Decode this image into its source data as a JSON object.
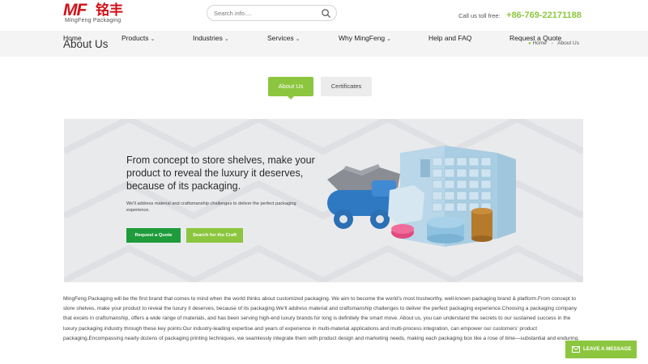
{
  "header": {
    "logo": {
      "mark": "MF",
      "cjk": "铭丰",
      "subtitle": "MingFeng Packaging"
    },
    "search": {
      "placeholder": "Search info....",
      "icon": "search-icon"
    },
    "tollfree": {
      "label": "Call us toll free:",
      "number": "+86-769-22171188"
    }
  },
  "nav": {
    "items": [
      {
        "label": "Home",
        "dropdown": false
      },
      {
        "label": "Products",
        "dropdown": true
      },
      {
        "label": "Industries",
        "dropdown": true
      },
      {
        "label": "Services",
        "dropdown": true
      },
      {
        "label": "Why MingFeng",
        "dropdown": true
      },
      {
        "label": "Help and FAQ",
        "dropdown": false
      },
      {
        "label": "Request a Quote",
        "dropdown": false
      }
    ],
    "chevron": "⌄"
  },
  "banner": {
    "title": "About Us",
    "breadcrumb": {
      "home": "Home",
      "current": "About Us"
    }
  },
  "tabs": [
    {
      "label": "About Us",
      "active": true
    },
    {
      "label": "Certificates",
      "active": false
    }
  ],
  "hero": {
    "title": "From concept to store shelves, make your product to reveal the luxury it deserves, because of its packaging.",
    "subtitle": "We'll address material and craftsmanship challenges to deliver the perfect packaging experience.",
    "buttons": {
      "quote": "Request a Quote",
      "craft": "Search for the Craft"
    }
  },
  "body_text": "MingFeng Packaging will be the first brand that comes to mind when the world thinks about customized packaging. We aim to become the world’s most trustworthy, well-known packaging brand & platform.From concept to store shelves, make your product to reveal the luxury it deserves, because of its packaging.We'll address material and craftsmanship challenges to deliver the perfect packaging experience.Choosing a packaging company that excels in craftsmanship, offers a wide range of materials, and has been serving high-end luxury brands for long is definitely the smart move. About us, you can understand the secrets to our sustained success in the luxury packaging industry through these key points:Our industry-leading expertise and years of experience in multi-material applications and multi-process integration, can empower our customers' product packaging.Encompassing nearly dozens of packaging printing techniques, we seamlessly integrate them with product design and marketing needs, making each packaging box like a rose of time—substantial and enduring.",
  "leave_message": {
    "label": "LEAVE A MESSAGE",
    "icon": "envelope-icon"
  },
  "colors": {
    "accent": "#8cc63f",
    "brand_red": "#d0121b",
    "dark_green": "#1e9b3a"
  }
}
